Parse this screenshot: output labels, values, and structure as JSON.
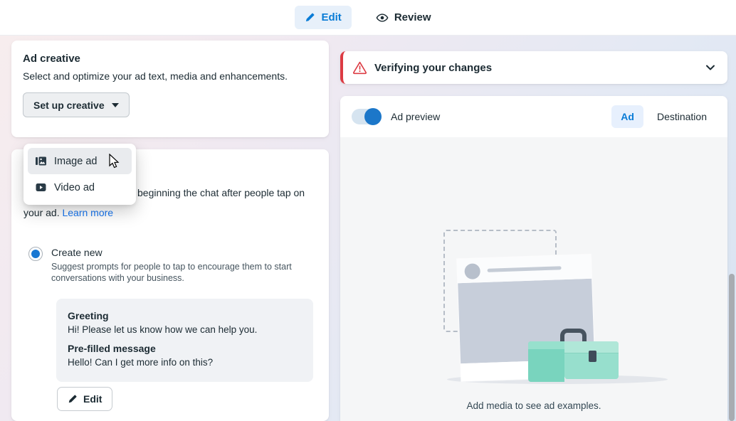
{
  "topbar": {
    "tabs": [
      {
        "label": "Edit"
      },
      {
        "label": "Review"
      }
    ]
  },
  "left_panel": {
    "ad_creative_card": {
      "title": "Ad creative",
      "subtitle": "Select and optimize your ad text, media and enhancements.",
      "setup_button_label": "Set up creative"
    },
    "creative_dropdown": {
      "items": [
        {
          "label": "Image ad"
        },
        {
          "label": "Video ad"
        }
      ]
    },
    "messaging_card": {
      "intro_visible_line1": "beginning the chat after people tap on",
      "intro_visible_line2": "your ad.",
      "learn_more_label": "Learn more",
      "create_new": {
        "label": "Create new",
        "description": "Suggest prompts for people to tap to encourage them to start conversations with your business."
      },
      "message_preview": {
        "greeting_label": "Greeting",
        "greeting_text": "Hi! Please let us know how we can help you.",
        "prefilled_label": "Pre-filled message",
        "prefilled_text": "Hello! Can I get more info on this?"
      },
      "edit_button_label": "Edit"
    }
  },
  "right_panel": {
    "warning_banner": {
      "title": "Verifying your changes"
    },
    "preview_card": {
      "toggle_label": "Ad preview",
      "toggle_state": "on",
      "tabs": [
        {
          "label": "Ad"
        },
        {
          "label": "Destination"
        }
      ],
      "empty_state_text": "Add media to see ad examples."
    }
  },
  "colors": {
    "accent_blue": "#0a7cd6",
    "link_blue": "#1877f2",
    "warning_red": "#dc3b43",
    "text_dark": "#1c2b33",
    "toggle_knob_blue": "#1c77c9",
    "toolbox_teal": "#79d4be",
    "preview_body_gray": "#f5f6f7"
  }
}
